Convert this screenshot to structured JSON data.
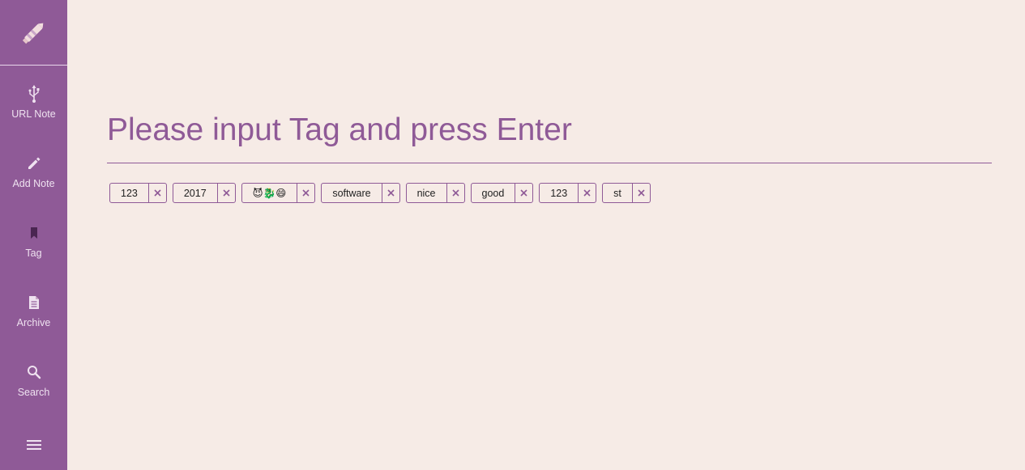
{
  "sidebar": {
    "logo_icon": "pencil-icon",
    "items": [
      {
        "label": "URL Note",
        "icon": "usb-icon"
      },
      {
        "label": "Add Note",
        "icon": "pencil-icon"
      },
      {
        "label": "Tag",
        "icon": "bookmark-icon"
      },
      {
        "label": "Archive",
        "icon": "document-icon"
      },
      {
        "label": "Search",
        "icon": "search-icon"
      }
    ],
    "menu_icon": "hamburger-menu-icon"
  },
  "main": {
    "tag_input": {
      "placeholder": "Please input Tag and press Enter",
      "value": ""
    },
    "tags": [
      {
        "label": "123"
      },
      {
        "label": "2017"
      },
      {
        "label": "😈🐉😄"
      },
      {
        "label": "software"
      },
      {
        "label": "nice"
      },
      {
        "label": "good"
      },
      {
        "label": "123"
      },
      {
        "label": "st"
      }
    ],
    "remove_icon": "close-icon"
  },
  "colors": {
    "sidebar_bg": "#8f5a97",
    "page_bg": "#f6ebe6",
    "accent": "#8f5a97"
  }
}
